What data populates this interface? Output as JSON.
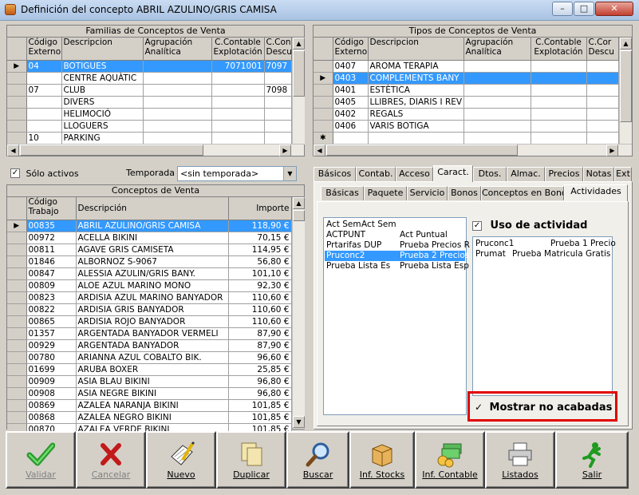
{
  "window": {
    "title": "Definición del concepto ABRIL AZULINO/GRIS CAMISA"
  },
  "familias": {
    "title": "Familias de Conceptos de Venta",
    "columns": [
      "Código Externo",
      "Descripcion",
      "Agrupación Analítica",
      "C.Contable Explotación",
      "C.Cont Descue"
    ],
    "rows": [
      {
        "codigo": "04",
        "desc": "BOTIGUES",
        "agrup": "",
        "cc": "7071001",
        "ccd": "7097",
        "sel": true
      },
      {
        "codigo": "",
        "desc": "CENTRE AQUÀTIC",
        "agrup": "",
        "cc": "",
        "ccd": ""
      },
      {
        "codigo": "07",
        "desc": "CLUB",
        "agrup": "",
        "cc": "",
        "ccd": "7098"
      },
      {
        "codigo": "",
        "desc": "DIVERS",
        "agrup": "",
        "cc": "",
        "ccd": ""
      },
      {
        "codigo": "",
        "desc": "HELIMOCIÓ",
        "agrup": "",
        "cc": "",
        "ccd": ""
      },
      {
        "codigo": "",
        "desc": "LLOGUERS",
        "agrup": "",
        "cc": "",
        "ccd": ""
      },
      {
        "codigo": "10",
        "desc": "PARKING",
        "agrup": "",
        "cc": "",
        "ccd": ""
      }
    ]
  },
  "tipos": {
    "title": "Tipos de Conceptos de Venta",
    "columns": [
      "Código Externo",
      "Descripcion",
      "Agrupación Analítica",
      "C.Contable Explotación",
      "C.Cor Descu"
    ],
    "rows": [
      {
        "codigo": "0407",
        "desc": "AROMA TERAPIA"
      },
      {
        "codigo": "0403",
        "desc": "COMPLEMENTS BANY",
        "sel": true
      },
      {
        "codigo": "0401",
        "desc": "ESTÈTICA"
      },
      {
        "codigo": "0405",
        "desc": "LLIBRES, DIARIS I REV"
      },
      {
        "codigo": "0402",
        "desc": "REGALS"
      },
      {
        "codigo": "0406",
        "desc": "VARIS BOTIGA"
      }
    ]
  },
  "filters": {
    "solo_activos": "Sólo activos",
    "temporada_label": "Temporada",
    "temporada_value": "<sin temporada>"
  },
  "conceptos": {
    "title": "Conceptos de Venta",
    "columns": [
      "Código Trabajo",
      "Descripción",
      "Importe"
    ],
    "rows": [
      {
        "codigo": "00835",
        "desc": "ABRIL AZULINO/GRIS CAMISA",
        "importe": "118,90 €",
        "sel": true
      },
      {
        "codigo": "00972",
        "desc": "ACELLA BIKINI",
        "importe": "70,15 €"
      },
      {
        "codigo": "00811",
        "desc": "AGAVE GRIS CAMISETA",
        "importe": "114,95 €"
      },
      {
        "codigo": "01846",
        "desc": "ALBORNOZ S-9067",
        "importe": "56,80 €"
      },
      {
        "codigo": "00847",
        "desc": "ALESSIA AZULIN/GRIS BANY.",
        "importe": "101,10 €"
      },
      {
        "codigo": "00809",
        "desc": "ALOE AZUL MARINO MONO",
        "importe": "92,30 €"
      },
      {
        "codigo": "00823",
        "desc": "ARDISIA AZUL MARINO BANYADOR",
        "importe": "110,60 €"
      },
      {
        "codigo": "00822",
        "desc": "ARDISIA GRIS BANYADOR",
        "importe": "110,60 €"
      },
      {
        "codigo": "00865",
        "desc": "ARDISIA ROJO BANYADOR",
        "importe": "110,60 €"
      },
      {
        "codigo": "01357",
        "desc": "ARGENTADA BANYADOR VERMELI",
        "importe": "87,90 €"
      },
      {
        "codigo": "00929",
        "desc": "ARGENTADA BANYADOR",
        "importe": "87,90 €"
      },
      {
        "codigo": "00780",
        "desc": "ARIANNA AZUL COBALTO BIK.",
        "importe": "96,60 €"
      },
      {
        "codigo": "01699",
        "desc": "ARUBA BOXER",
        "importe": "25,85 €"
      },
      {
        "codigo": "00909",
        "desc": "ASIA BLAU BIKINI",
        "importe": "96,80 €"
      },
      {
        "codigo": "00908",
        "desc": "ASIA NEGRE BIKINI",
        "importe": "96,80 €"
      },
      {
        "codigo": "00869",
        "desc": "AZALEA NARANJA BIKINI",
        "importe": "101,85 €"
      },
      {
        "codigo": "00868",
        "desc": "AZALEA NEGRO BIKINI",
        "importe": "101,85 €"
      },
      {
        "codigo": "00870",
        "desc": "AZALEA VERDE BIKINI",
        "importe": "101,85 €"
      }
    ]
  },
  "tabs_main": [
    "Básicos",
    "Contab.",
    "Acceso",
    "Caract.",
    "Dtos.",
    "Almac.",
    "Precios",
    "Notas",
    "Ext"
  ],
  "tabs_sub": [
    "Básicas",
    "Paquete",
    "Servicio",
    "Bonos",
    "Conceptos en Bono",
    "Actividades"
  ],
  "actividades": {
    "list": [
      {
        "a": "Act Sem",
        "b": "Act Sem"
      },
      {
        "a": "ACTPUNT",
        "b": "Act Puntual"
      },
      {
        "a": "Prtarifas DUP",
        "b": "Prueba Precios R"
      },
      {
        "a": "Pruconc2",
        "b": "Prueba 2 Precios",
        "sel": true
      },
      {
        "a": "Prueba Lista Es",
        "b": "Prueba Lista Esp"
      }
    ],
    "uso_label": "Uso de actividad",
    "uso_list": [
      {
        "a": "Pruconc1",
        "b": "Prueba 1 Precio"
      },
      {
        "a": "Prumat",
        "b": "Prueba Matricula Gratis"
      }
    ],
    "mostrar_label": "Mostrar no acabadas",
    "highlight_color": "#e00000"
  },
  "buttons": [
    {
      "label": "Validar",
      "icon": "check-icon",
      "disabled": true
    },
    {
      "label": "Cancelar",
      "icon": "x-icon",
      "disabled": true
    },
    {
      "label": "Nuevo",
      "icon": "new-document-icon"
    },
    {
      "label": "Duplicar",
      "icon": "duplicate-icon"
    },
    {
      "label": "Buscar",
      "icon": "magnifier-icon"
    },
    {
      "label": "Inf. Stocks",
      "icon": "box-icon"
    },
    {
      "label": "Inf. Contable",
      "icon": "money-icon"
    },
    {
      "label": "Listados",
      "icon": "printer-icon"
    },
    {
      "label": "Salir",
      "icon": "running-man-icon"
    }
  ]
}
